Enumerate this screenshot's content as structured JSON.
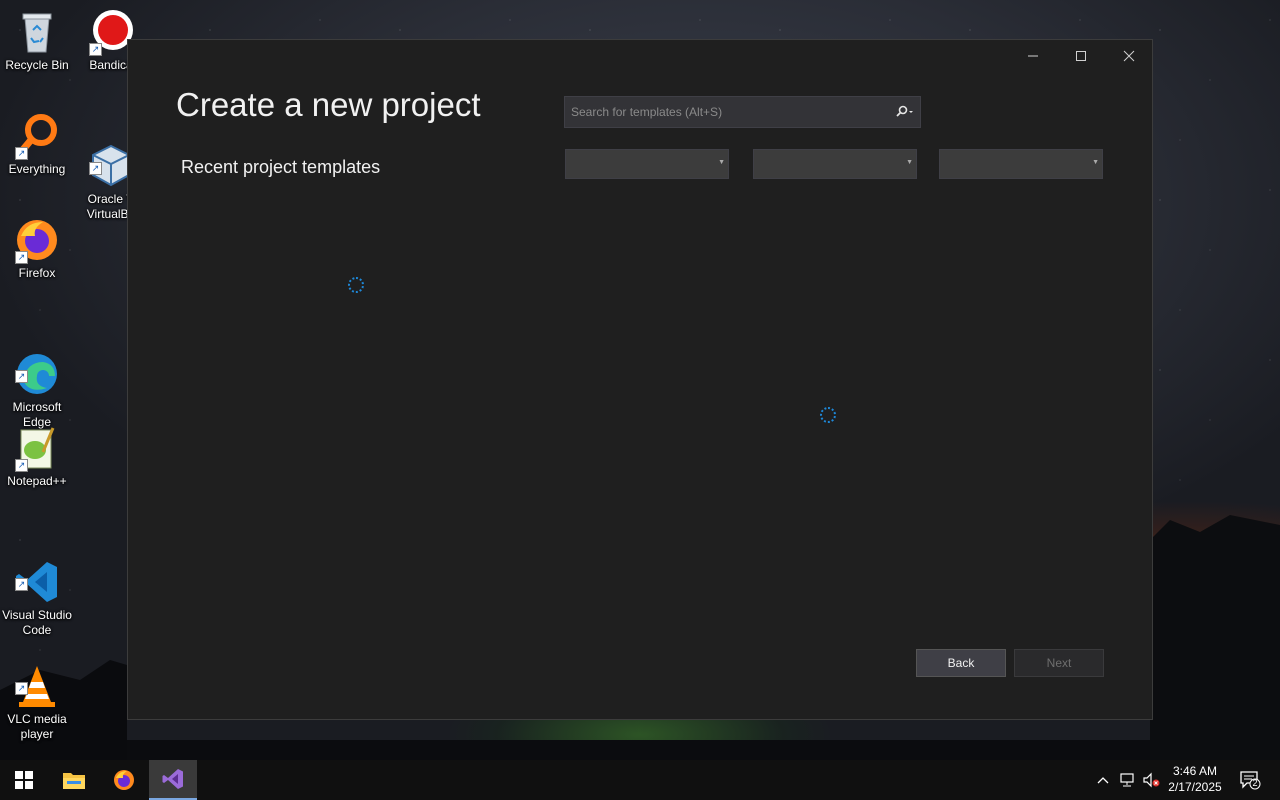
{
  "desktop": {
    "icons": [
      {
        "label": "Recycle Bin",
        "icon": "recycle-bin-icon"
      },
      {
        "label": "Bandica",
        "icon": "bandicam-icon"
      },
      {
        "label": "Everything",
        "icon": "everything-search-icon"
      },
      {
        "label": "Oracle V\nVirtualBo",
        "icon": "virtualbox-icon"
      },
      {
        "label": "Firefox",
        "icon": "firefox-icon"
      },
      {
        "label": "Microsoft\nEdge",
        "icon": "edge-icon"
      },
      {
        "label": "Notepad++",
        "icon": "notepadpp-icon"
      },
      {
        "label": "Visual Studio\nCode",
        "icon": "vscode-icon"
      },
      {
        "label": "VLC media\nplayer",
        "icon": "vlc-icon"
      }
    ]
  },
  "dialog": {
    "title": "Create a new project",
    "recent_label": "Recent project templates",
    "search": {
      "placeholder": "Search for templates (Alt+S)",
      "value": ""
    },
    "filters": [
      {
        "selected": ""
      },
      {
        "selected": ""
      },
      {
        "selected": ""
      }
    ],
    "back_label": "Back",
    "next_label": "Next",
    "next_enabled": false,
    "accent_color": "#1e88d8"
  },
  "taskbar": {
    "apps": [
      {
        "name": "file-explorer-icon"
      },
      {
        "name": "firefox-icon"
      },
      {
        "name": "visual-studio-icon",
        "active": true
      }
    ],
    "clock": {
      "time": "3:46 AM",
      "date": "2/17/2025"
    },
    "notifications_count": "2"
  }
}
